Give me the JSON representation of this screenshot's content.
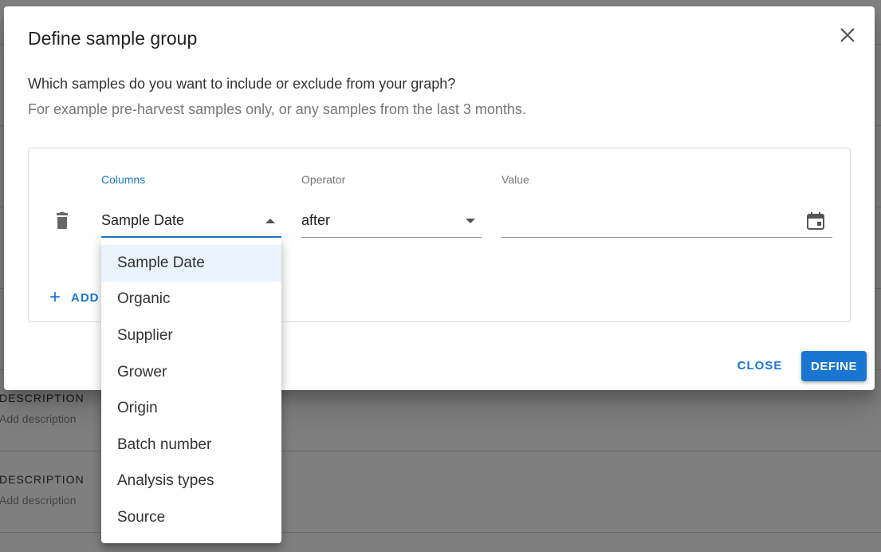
{
  "background": {
    "rows": [
      {
        "label": "DESCRIPTION",
        "sub": "Add description"
      },
      {
        "label": "DESCRIPTION",
        "sub": "Add description"
      }
    ]
  },
  "dialog": {
    "title": "Define sample group",
    "description_line1": "Which samples do you want to include or exclude from your graph?",
    "description_line2": "For example pre-harvest samples only, or any samples from the last 3 months.",
    "filter": {
      "columns_label": "Columns",
      "columns_value": "Sample Date",
      "operator_label": "Operator",
      "operator_value": "after",
      "value_label": "Value",
      "value_value": ""
    },
    "add_label": "ADD",
    "close_label": "CLOSE",
    "define_label": "DEFINE",
    "accent_color": "#1976d2"
  },
  "columns_menu": {
    "selected": "Sample Date",
    "options": [
      "Sample Date",
      "Organic",
      "Supplier",
      "Grower",
      "Origin",
      "Batch number",
      "Analysis types",
      "Source"
    ]
  }
}
